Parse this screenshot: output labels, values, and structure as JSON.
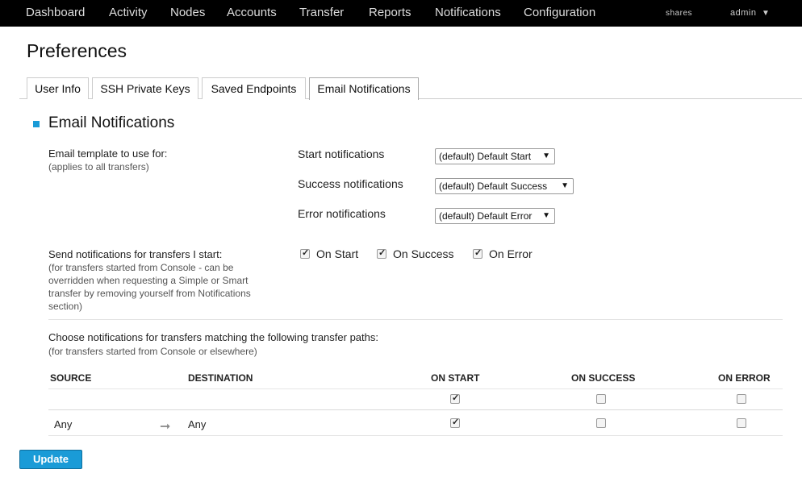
{
  "nav": {
    "items": [
      "Dashboard",
      "Activity",
      "Nodes",
      "Accounts",
      "Transfer",
      "Reports",
      "Notifications",
      "Configuration"
    ],
    "shares": "shares",
    "user": "admin",
    "user_caret": "▼"
  },
  "page_title": "Preferences",
  "tabs": [
    "User Info",
    "SSH Private Keys",
    "Saved Endpoints",
    "Email Notifications"
  ],
  "active_tab": "Email Notifications",
  "section_title": "Email Notifications",
  "templates": {
    "label": "Email template to use for:",
    "sublabel": "(applies to all transfers)",
    "start_label": "Start notifications",
    "start_value": "(default) Default Start",
    "success_label": "Success notifications",
    "success_value": "(default) Default Success",
    "error_label": "Error notifications",
    "error_value": "(default) Default Error",
    "caret": "▼"
  },
  "send": {
    "label": "Send notifications for transfers I start:",
    "sublabel_lines": [
      "(for transfers started from Console - can be",
      "overridden when requesting a Simple or Smart",
      "transfer by removing yourself from Notifications",
      "section)"
    ],
    "on_start": "On Start",
    "on_success": "On Success",
    "on_error": "On Error",
    "on_start_checked": true,
    "on_success_checked": true,
    "on_error_checked": true
  },
  "paths": {
    "label": "Choose notifications for transfers matching the following transfer paths:",
    "sublabel": "(for transfers started from Console or elsewhere)",
    "headers": {
      "source": "SOURCE",
      "destination": "DESTINATION",
      "on_start": "ON START",
      "on_success": "ON SUCCESS",
      "on_error": "ON ERROR"
    },
    "rows": [
      {
        "source": "",
        "destination": "",
        "on_start": true,
        "on_success": false,
        "on_error": false
      },
      {
        "source": "Any",
        "arrow": "➞",
        "destination": "Any",
        "on_start": true,
        "on_success": false,
        "on_error": false
      }
    ]
  },
  "update_label": "Update",
  "colors": {
    "accent": "#1a9bd7",
    "nav_bg": "#000000"
  }
}
